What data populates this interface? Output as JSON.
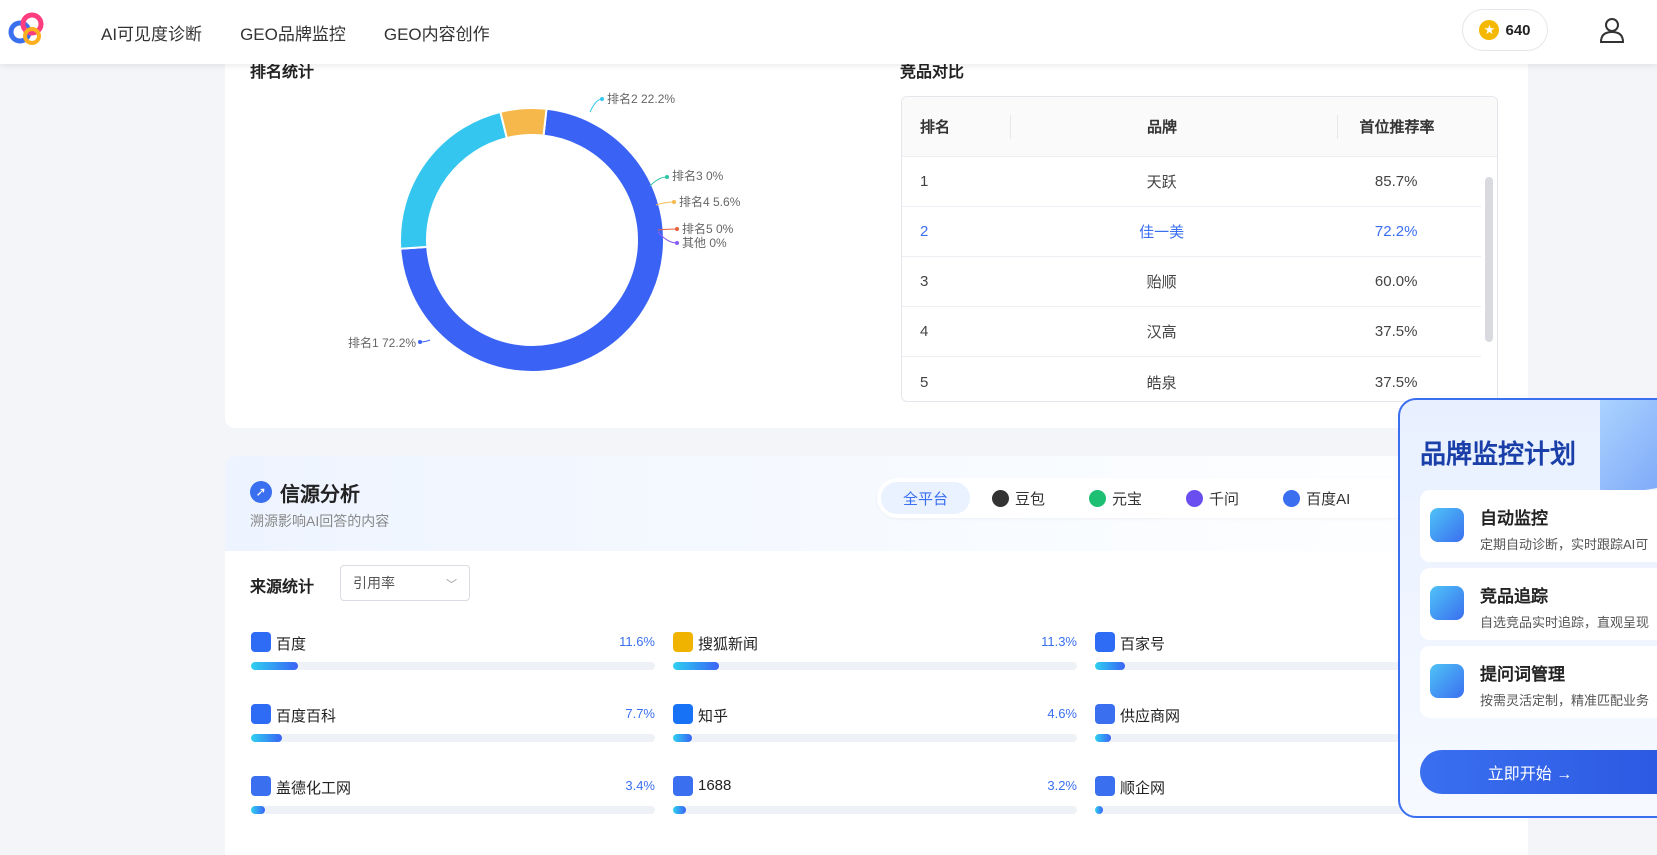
{
  "nav": {
    "items": [
      "AI可见度诊断",
      "GEO品牌监控",
      "GEO内容创作"
    ]
  },
  "points": {
    "value": "640"
  },
  "ranking": {
    "title": "排名统计",
    "chart_data": {
      "type": "pie",
      "title": "排名统计",
      "labels": [
        "排名1",
        "排名2",
        "排名3",
        "排名4",
        "排名5",
        "其他"
      ],
      "values": [
        72.2,
        22.2,
        0,
        5.6,
        0,
        0
      ],
      "colors": [
        "#3a63f5",
        "#35c6ef",
        "#2ec4a6",
        "#f7b84b",
        "#e8603c",
        "#8a5cf6"
      ],
      "label_texts": [
        "排名1 72.2%",
        "排名2 22.2%",
        "排名3 0%",
        "排名4 5.6%",
        "排名5 0%",
        "其他 0%"
      ]
    }
  },
  "compare": {
    "title": "竞品对比",
    "headers": [
      "排名",
      "品牌",
      "首位推荐率"
    ],
    "rows": [
      [
        "1",
        "天跃",
        "85.7%"
      ],
      [
        "2",
        "佳一美",
        "72.2%"
      ],
      [
        "3",
        "贻顺",
        "60.0%"
      ],
      [
        "4",
        "汉高",
        "37.5%"
      ],
      [
        "5",
        "皓泉",
        "37.5%"
      ]
    ]
  },
  "sources": {
    "title": "信源分析",
    "subtitle": "溯源影响AI回答的内容",
    "platforms": [
      "全平台",
      "豆包",
      "元宝",
      "千问",
      "百度AI"
    ],
    "platform_colors": [
      "#3a6ff0",
      "#333333",
      "#1dbf73",
      "#6b4ef0",
      "#3a6ff0"
    ],
    "stat_label": "来源统计",
    "metric_select": "引用率",
    "items": [
      {
        "name": "百度",
        "pct": "11.6%",
        "value": 11.6,
        "icon": "baidu-icon",
        "color": "#2f6cf6"
      },
      {
        "name": "搜狐新闻",
        "pct": "11.3%",
        "value": 11.3,
        "icon": "sohu-icon",
        "color": "#f0b400"
      },
      {
        "name": "百家号",
        "pct": "",
        "value": 7.5,
        "icon": "baijiahao-icon",
        "color": "#2f6cf6"
      },
      {
        "name": "百度百科",
        "pct": "7.7%",
        "value": 7.7,
        "icon": "baidu-icon",
        "color": "#2f6cf6"
      },
      {
        "name": "知乎",
        "pct": "4.6%",
        "value": 4.6,
        "icon": "zhihu-icon",
        "color": "#1772f6"
      },
      {
        "name": "供应商网",
        "pct": "",
        "value": 4.0,
        "icon": "doc-icon",
        "color": "#3a6ff0"
      },
      {
        "name": "盖德化工网",
        "pct": "3.4%",
        "value": 3.4,
        "icon": "doc-icon",
        "color": "#3a6ff0"
      },
      {
        "name": "1688",
        "pct": "3.2%",
        "value": 3.2,
        "icon": "doc-icon",
        "color": "#3a6ff0"
      },
      {
        "name": "顺企网",
        "pct": "",
        "value": 2.0,
        "icon": "doc-icon",
        "color": "#3a6ff0"
      }
    ]
  },
  "promo": {
    "title": "品牌监控计划",
    "items": [
      {
        "title": "自动监控",
        "desc": "定期自动诊断，实时跟踪AI可"
      },
      {
        "title": "竞品追踪",
        "desc": "自选竞品实时追踪，直观呈现"
      },
      {
        "title": "提问词管理",
        "desc": "按需灵活定制，精准匹配业务"
      }
    ],
    "button": "立即开始 →"
  }
}
